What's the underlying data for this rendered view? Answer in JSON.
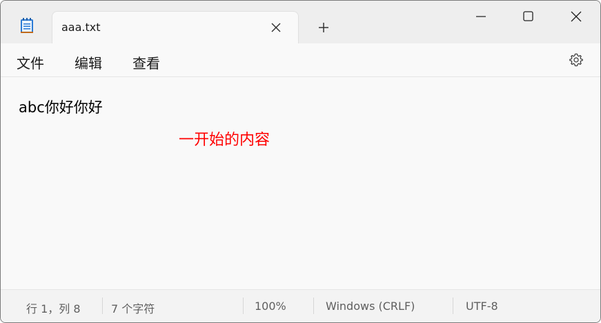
{
  "titlebar": {
    "tab_title": "aaa.txt",
    "icons": {
      "app": "notepad-icon",
      "tab_close": "close-icon",
      "new_tab": "plus-icon",
      "minimize": "minimize-icon",
      "maximize": "maximize-icon",
      "close": "close-icon"
    }
  },
  "menu": {
    "file": "文件",
    "edit": "编辑",
    "view": "查看",
    "settings_icon": "gear-icon"
  },
  "editor": {
    "content": "abc你好你好",
    "annotation": "一开始的内容",
    "annotation_color": "#ff0000"
  },
  "status": {
    "position": "行 1，列 8",
    "char_count": "7 个字符",
    "zoom": "100%",
    "line_ending": "Windows (CRLF)",
    "encoding": "UTF-8"
  }
}
